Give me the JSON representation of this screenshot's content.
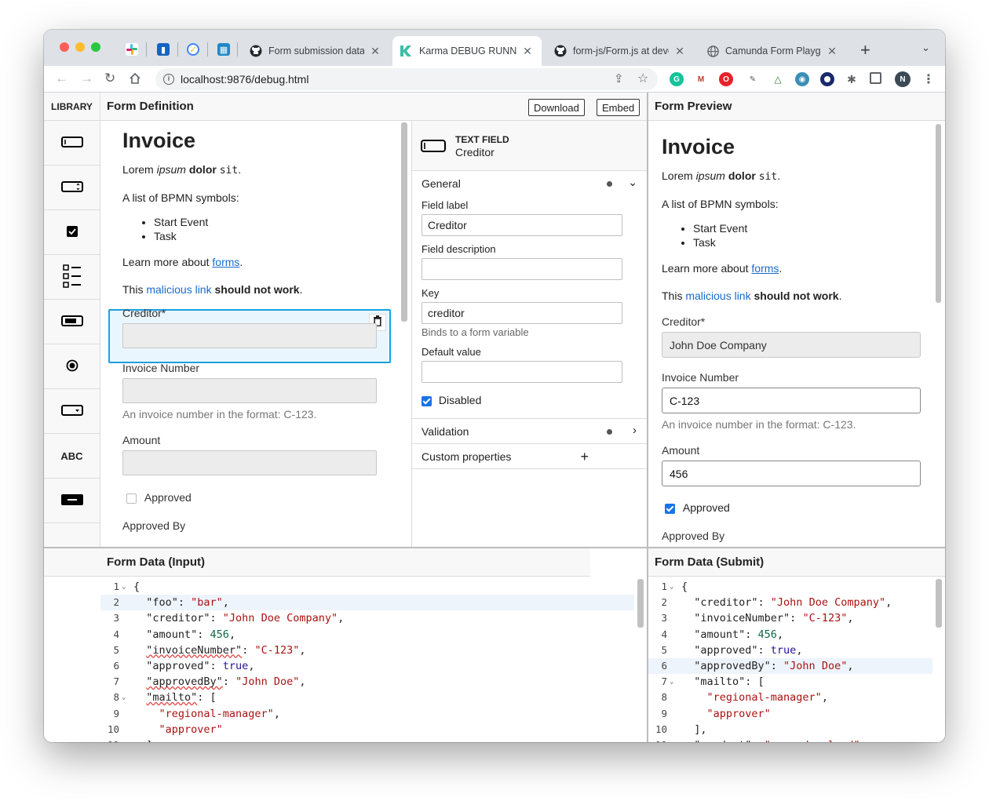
{
  "browser": {
    "tabs": [
      {
        "title": "Form submission data"
      },
      {
        "title": "Karma DEBUG RUNNER"
      },
      {
        "title": "form-js/Form.js at deve"
      },
      {
        "title": "Camunda Form Playgro"
      }
    ],
    "url": "localhost:9876/debug.html",
    "profile_initial": "N"
  },
  "library": {
    "title": "LIBRARY",
    "items": [
      {
        "icon": "textfield-icon"
      },
      {
        "icon": "number-icon"
      },
      {
        "icon": "checkbox-icon"
      },
      {
        "icon": "checklist-icon"
      },
      {
        "icon": "taglist-icon"
      },
      {
        "icon": "radio-icon"
      },
      {
        "icon": "select-icon"
      },
      {
        "icon": "text-icon",
        "label": "ABC"
      },
      {
        "icon": "button-icon"
      }
    ]
  },
  "definition": {
    "title": "Form Definition",
    "download_label": "Download",
    "embed_label": "Embed",
    "form_title": "Invoice",
    "lorem": {
      "a": "Lorem ",
      "b": "ipsum",
      "c": " ",
      "d": "dolor",
      "e": " ",
      "f": "sit",
      "g": "."
    },
    "list_intro": "A list of BPMN symbols:",
    "list_items": [
      "Start Event",
      "Task"
    ],
    "learn_prefix": "Learn more about ",
    "learn_link": "forms",
    "learn_suffix": ".",
    "mal_prefix": "This ",
    "mal_link": "malicious link",
    "mal_suffix": " should not work",
    "mal_end": ".",
    "creditor_label": "Creditor*",
    "invoice_label": "Invoice Number",
    "invoice_desc": "An invoice number in the format: C-123.",
    "amount_label": "Amount",
    "approved_label": "Approved",
    "approvedby_label": "Approved By"
  },
  "properties": {
    "type": "TEXT FIELD",
    "name": "Creditor",
    "general_label": "General",
    "field_label_label": "Field label",
    "field_label_value": "Creditor",
    "field_desc_label": "Field description",
    "field_desc_value": "",
    "key_label": "Key",
    "key_value": "creditor",
    "key_desc": "Binds to a form variable",
    "default_label": "Default value",
    "default_value": "",
    "disabled_label": "Disabled",
    "disabled_checked": true,
    "validation_label": "Validation",
    "custom_label": "Custom properties"
  },
  "preview": {
    "title": "Form Preview",
    "form_title": "Invoice",
    "creditor_label": "Creditor*",
    "creditor_value": "John Doe Company",
    "invoice_label": "Invoice Number",
    "invoice_value": "C-123",
    "invoice_desc": "An invoice number in the format: C-123.",
    "amount_label": "Amount",
    "amount_value": "456",
    "approved_label": "Approved",
    "approved_checked": true,
    "approvedby_label": "Approved By"
  },
  "input_data": {
    "title": "Form Data (Input)",
    "lines": [
      {
        "n": "1",
        "fold": true,
        "parts": [
          {
            "t": "{",
            "c": "k"
          }
        ]
      },
      {
        "n": "2",
        "hl": true,
        "parts": [
          {
            "t": "  \"foo\": ",
            "c": "k"
          },
          {
            "t": "\"bar\"",
            "c": "s"
          },
          {
            "t": ",",
            "c": "k"
          }
        ]
      },
      {
        "n": "3",
        "parts": [
          {
            "t": "  \"creditor\": ",
            "c": "k"
          },
          {
            "t": "\"John Doe Company\"",
            "c": "s"
          },
          {
            "t": ",",
            "c": "k"
          }
        ]
      },
      {
        "n": "4",
        "parts": [
          {
            "t": "  \"amount\": ",
            "c": "k"
          },
          {
            "t": "456",
            "c": "n"
          },
          {
            "t": ",",
            "c": "k"
          }
        ]
      },
      {
        "n": "5",
        "parts": [
          {
            "t": "  ",
            "c": "k"
          },
          {
            "t": "\"invoiceNumber\"",
            "c": "k sq"
          },
          {
            "t": ": ",
            "c": "k"
          },
          {
            "t": "\"C-123\"",
            "c": "s"
          },
          {
            "t": ",",
            "c": "k"
          }
        ]
      },
      {
        "n": "6",
        "parts": [
          {
            "t": "  \"approved\": ",
            "c": "k"
          },
          {
            "t": "true",
            "c": "b"
          },
          {
            "t": ",",
            "c": "k"
          }
        ]
      },
      {
        "n": "7",
        "parts": [
          {
            "t": "  ",
            "c": "k"
          },
          {
            "t": "\"approvedBy\"",
            "c": "k sq"
          },
          {
            "t": ": ",
            "c": "k"
          },
          {
            "t": "\"John Doe\"",
            "c": "s"
          },
          {
            "t": ",",
            "c": "k"
          }
        ]
      },
      {
        "n": "8",
        "fold": true,
        "parts": [
          {
            "t": "  ",
            "c": "k"
          },
          {
            "t": "\"mailto\"",
            "c": "k sq"
          },
          {
            "t": ": [",
            "c": "k"
          }
        ]
      },
      {
        "n": "9",
        "parts": [
          {
            "t": "    \"regional-manager\"",
            "c": "s"
          },
          {
            "t": ",",
            "c": "k"
          }
        ]
      },
      {
        "n": "10",
        "parts": [
          {
            "t": "    \"approver\"",
            "c": "s"
          }
        ]
      },
      {
        "n": "11",
        "parts": [
          {
            "t": "  ],",
            "c": "k"
          }
        ]
      }
    ]
  },
  "submit_data": {
    "title": "Form Data (Submit)",
    "lines": [
      {
        "n": "1",
        "fold": true,
        "parts": [
          {
            "t": "{",
            "c": "k"
          }
        ]
      },
      {
        "n": "2",
        "parts": [
          {
            "t": "  \"creditor\": ",
            "c": "k"
          },
          {
            "t": "\"John Doe Company\"",
            "c": "s"
          },
          {
            "t": ",",
            "c": "k"
          }
        ]
      },
      {
        "n": "3",
        "parts": [
          {
            "t": "  \"invoiceNumber\": ",
            "c": "k"
          },
          {
            "t": "\"C-123\"",
            "c": "s"
          },
          {
            "t": ",",
            "c": "k"
          }
        ]
      },
      {
        "n": "4",
        "parts": [
          {
            "t": "  \"amount\": ",
            "c": "k"
          },
          {
            "t": "456",
            "c": "n"
          },
          {
            "t": ",",
            "c": "k"
          }
        ]
      },
      {
        "n": "5",
        "parts": [
          {
            "t": "  \"approved\": ",
            "c": "k"
          },
          {
            "t": "true",
            "c": "b"
          },
          {
            "t": ",",
            "c": "k"
          }
        ]
      },
      {
        "n": "6",
        "hl": true,
        "parts": [
          {
            "t": "  \"approvedBy\": ",
            "c": "k"
          },
          {
            "t": "\"John Doe\"",
            "c": "s"
          },
          {
            "t": ",",
            "c": "k"
          }
        ]
      },
      {
        "n": "7",
        "fold": true,
        "parts": [
          {
            "t": "  \"mailto\": [",
            "c": "k"
          }
        ]
      },
      {
        "n": "8",
        "parts": [
          {
            "t": "    \"regional-manager\"",
            "c": "s"
          },
          {
            "t": ",",
            "c": "k"
          }
        ]
      },
      {
        "n": "9",
        "parts": [
          {
            "t": "    \"approver\"",
            "c": "s"
          }
        ]
      },
      {
        "n": "10",
        "parts": [
          {
            "t": "  ],",
            "c": "k"
          }
        ]
      },
      {
        "n": "11",
        "parts": [
          {
            "t": "  \"product\": ",
            "c": "k"
          },
          {
            "t": "\"camunda-cloud\"",
            "c": "s"
          }
        ]
      }
    ]
  },
  "colors": {
    "accent": "#1a73e8",
    "selection": "#1aa0e0",
    "link": "#1a6bc9",
    "string": "#aa1111"
  }
}
